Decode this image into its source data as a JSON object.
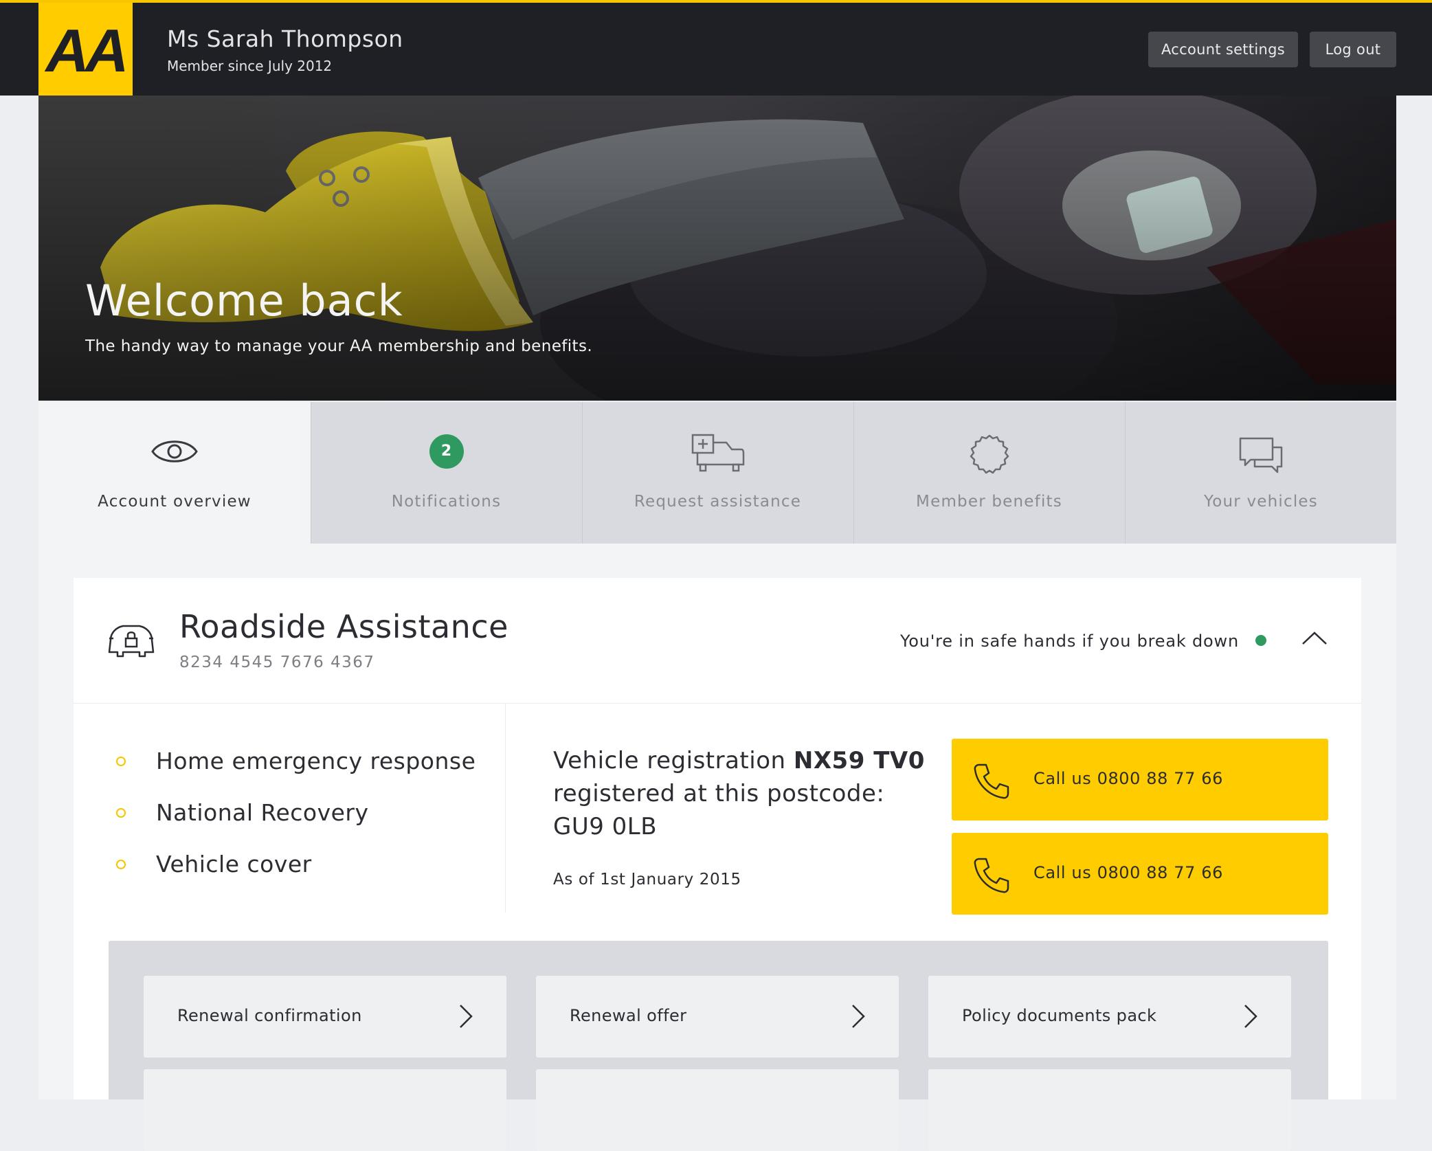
{
  "header": {
    "logo_text": "AA",
    "user_name": "Ms Sarah Thompson",
    "member_since": "Member since July 2012",
    "account_settings_label": "Account settings",
    "logout_label": "Log out"
  },
  "hero": {
    "title": "Welcome back",
    "subtitle": "The handy way to manage your AA membership and benefits."
  },
  "tabs": [
    {
      "label": "Account overview",
      "icon": "eye-icon",
      "active": true
    },
    {
      "label": "Notifications",
      "badge": "2",
      "active": false
    },
    {
      "label": "Request assistance",
      "icon": "car-plus-icon",
      "active": false
    },
    {
      "label": "Member benefits",
      "icon": "badge-icon",
      "active": false
    },
    {
      "label": "Your vehicles",
      "icon": "chat-bubbles-icon",
      "active": false
    }
  ],
  "card": {
    "title": "Roadside Assistance",
    "number": "8234 4545 7676 4367",
    "status_text": "You're in safe hands if you break down",
    "status_color": "#2f9a60",
    "features": [
      "Home emergency response",
      "National Recovery",
      "Vehicle cover"
    ],
    "vehicle": {
      "prefix": "Vehicle registration",
      "registration": "NX59 TV0",
      "line2": "registered at this postcode:",
      "postcode": "GU9 0LB",
      "as_of": "As of 1st January 2015"
    },
    "call_buttons": [
      {
        "label": "Call us 0800 88 77 66"
      },
      {
        "label": "Call us 0800 88 77 66"
      }
    ],
    "documents": [
      "Renewal confirmation",
      "Renewal offer",
      "Policy documents pack"
    ]
  },
  "colors": {
    "brand_yellow": "#ffcc00",
    "header_dark": "#1f2025",
    "success_green": "#2f9a60"
  }
}
